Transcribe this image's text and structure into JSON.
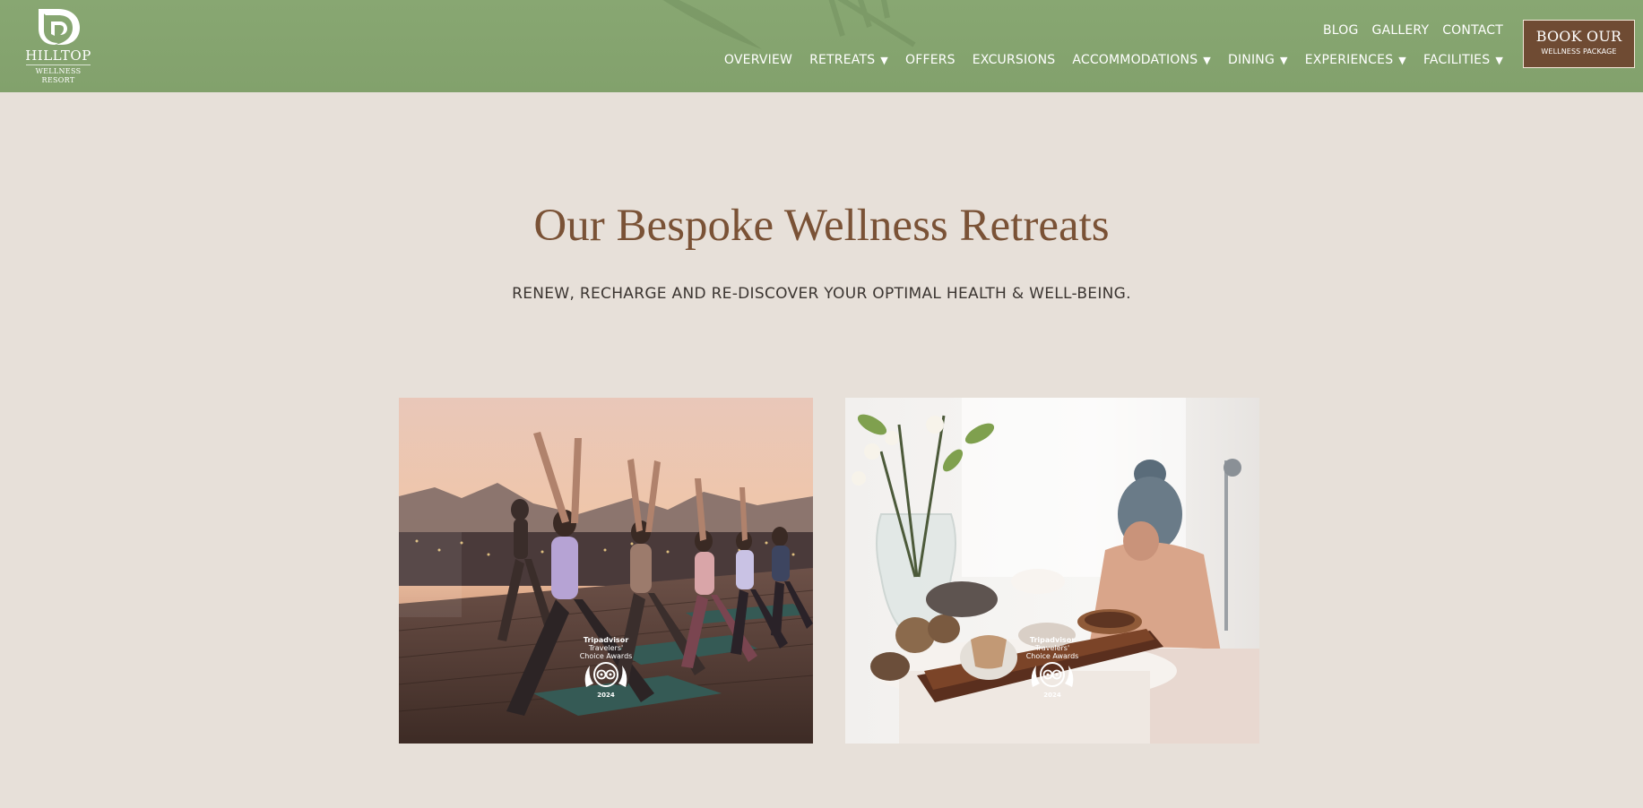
{
  "header": {
    "logo": {
      "name": "HILLTOP",
      "tagline": "WELLNESS RESORT"
    },
    "util_nav": [
      {
        "label": "BLOG"
      },
      {
        "label": "GALLERY"
      },
      {
        "label": "CONTACT"
      }
    ],
    "main_nav": [
      {
        "label": "OVERVIEW",
        "dropdown": false
      },
      {
        "label": "RETREATS",
        "dropdown": true
      },
      {
        "label": "OFFERS",
        "dropdown": false
      },
      {
        "label": "EXCURSIONS",
        "dropdown": false
      },
      {
        "label": "ACCOMMODATIONS",
        "dropdown": true
      },
      {
        "label": "DINING",
        "dropdown": true
      },
      {
        "label": "EXPERIENCES",
        "dropdown": true
      },
      {
        "label": "FACILITIES",
        "dropdown": true
      }
    ],
    "caret_glyph": "▼",
    "book_button": {
      "label": "BOOK OUR",
      "sublabel": "WELLNESS PACKAGE"
    }
  },
  "hero": {
    "title": "Our Bespoke Wellness Retreats",
    "subtitle": "RENEW, RECHARGE AND RE-DISCOVER YOUR OPTIMAL HEALTH & WELL-BEING."
  },
  "cards": [
    {
      "image": "rooftop-yoga-photo",
      "badge": {
        "line1": "Tripadvisor",
        "line2": "Travelers'",
        "line3": "Choice Awards",
        "year": "2024"
      }
    },
    {
      "image": "spa-bath-photo",
      "badge": {
        "line1": "Tripadvisor",
        "line2": "Travelers'",
        "line3": "Choice Awards",
        "year": "2024"
      }
    }
  ],
  "colors": {
    "header_bg": "#84a36e",
    "page_bg": "#e7e0d9",
    "title": "#7a5236",
    "button_bg": "#6f4b33"
  }
}
